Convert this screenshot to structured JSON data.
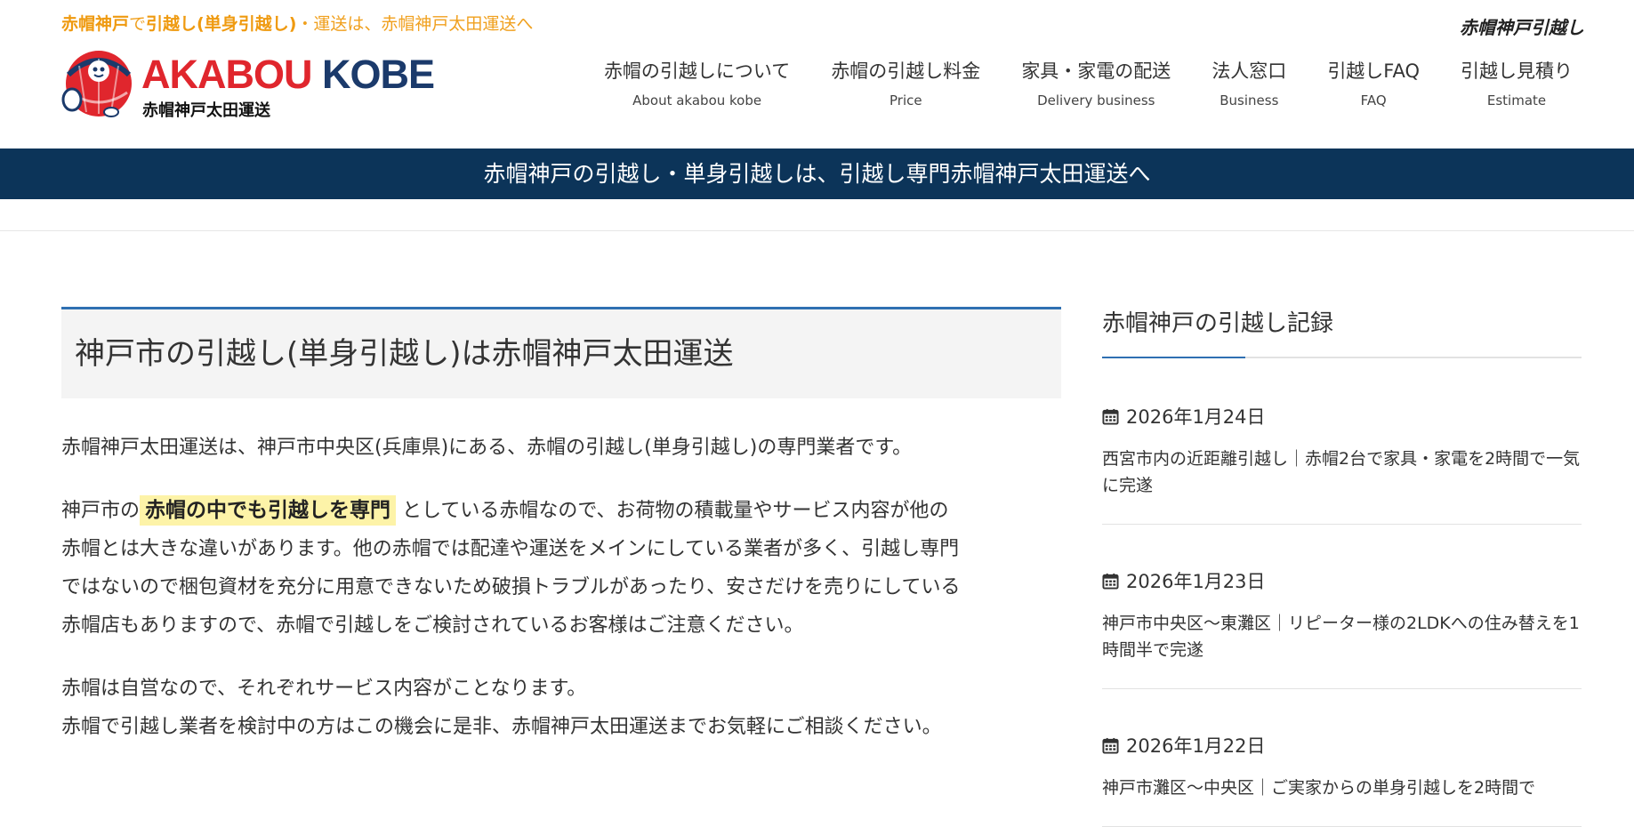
{
  "header": {
    "tagline_parts": [
      "赤帽神戸",
      "で",
      "引越し(単身引越し)",
      "・運送は、赤帽神戸太田運送へ"
    ],
    "right_label": "赤帽神戸引越し",
    "logo": {
      "brand_red": "AKABOU",
      "brand_navy": "KOBE",
      "sub": "赤帽神戸太田運送"
    },
    "nav": [
      {
        "label": "赤帽の引越しについて",
        "sub": "About akabou kobe"
      },
      {
        "label": "赤帽の引越し料金",
        "sub": "Price"
      },
      {
        "label": "家具・家電の配送",
        "sub": "Delivery business"
      },
      {
        "label": "法人窓口",
        "sub": "Business"
      },
      {
        "label": "引越しFAQ",
        "sub": "FAQ"
      },
      {
        "label": "引越し見積り",
        "sub": "Estimate"
      }
    ]
  },
  "banner": {
    "text": "赤帽神戸の引越し・単身引越しは、引越し専門赤帽神戸太田運送へ"
  },
  "main": {
    "title": "神戸市の引越し(単身引越し)は赤帽神戸太田運送",
    "para1": "赤帽神戸太田運送は、神戸市中央区(兵庫県)にある、赤帽の引越し(単身引越し)の専門業者です。",
    "para2_before": "神戸市の",
    "para2_highlight": "赤帽の中でも引越しを専門",
    "para2_line1_after": "としている赤帽なので、お荷物の積載量やサービス内容が他の",
    "para2_line2": "赤帽とは大きな違いがあります。他の赤帽では配達や運送をメインにしている業者が多く、引越し専門",
    "para2_line3": "ではないので梱包資材を充分に用意できないため破損トラブルがあったり、安さだけを売りにしている",
    "para2_line4": "赤帽店もありますので、赤帽で引越しをご検討されているお客様はご注意ください。",
    "para3_line1": "赤帽は自営なので、それぞれサービス内容がことなります。",
    "para3_line2": "赤帽で引越し業者を検討中の方はこの機会に是非、赤帽神戸太田運送までお気軽にご相談ください。"
  },
  "sidebar": {
    "title": "赤帽神戸の引越し記録",
    "posts": [
      {
        "date": "2026年1月24日",
        "title": "西宮市内の近距離引越し｜赤帽2台で家具・家電を2時間で一気に完遂"
      },
      {
        "date": "2026年1月23日",
        "title": "神戸市中央区～東灘区｜リピーター様の2LDKへの住み替えを1時間半で完遂"
      },
      {
        "date": "2026年1月22日",
        "title": "神戸市灘区～中央区｜ご実家からの単身引越しを2時間で"
      }
    ]
  },
  "colors": {
    "accent_orange": "#f0a01e",
    "navy": "#0c3459",
    "title_blue": "#2f70b2",
    "logo_red": "#e0262d",
    "highlight": "#fdf3a8"
  },
  "icons": {
    "date_icon": "calendar-icon"
  }
}
